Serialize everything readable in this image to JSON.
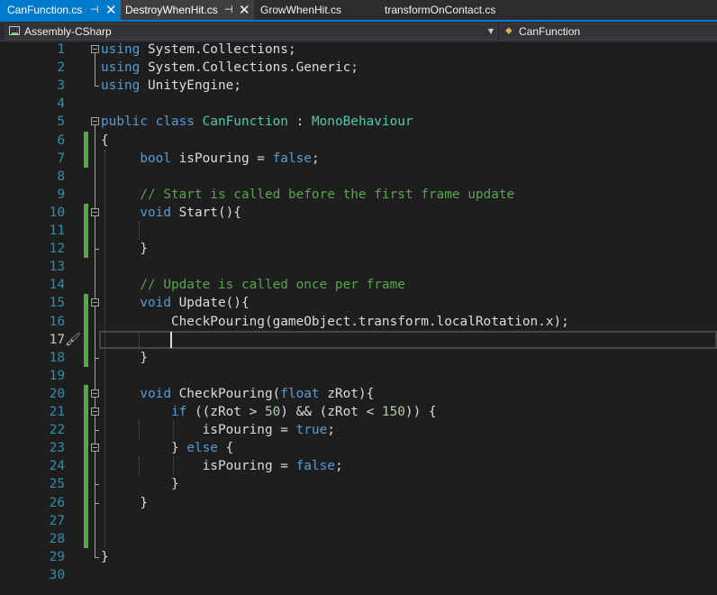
{
  "tabs": [
    {
      "label": "CanFunction.cs",
      "state": "active"
    },
    {
      "label": "DestroyWhenHit.cs",
      "state": "pinned"
    },
    {
      "label": "GrowWhenHit.cs",
      "state": "plain"
    },
    {
      "label": "transformOnContact.cs",
      "state": "plain"
    }
  ],
  "navbar": {
    "project": "Assembly-CSharp",
    "member": "CanFunction"
  },
  "editor": {
    "current_line": 17,
    "lines": [
      {
        "num": "1",
        "segments": [
          {
            "t": "using",
            "c": "k"
          },
          {
            "t": " System.Collections;"
          }
        ]
      },
      {
        "num": "2",
        "segments": [
          {
            "t": "using",
            "c": "k"
          },
          {
            "t": " System.Collections.Generic;"
          }
        ]
      },
      {
        "num": "3",
        "segments": [
          {
            "t": "using",
            "c": "k"
          },
          {
            "t": " UnityEngine;"
          }
        ]
      },
      {
        "num": "4",
        "segments": []
      },
      {
        "num": "5",
        "segments": [
          {
            "t": "public",
            "c": "k"
          },
          {
            "t": " "
          },
          {
            "t": "class",
            "c": "k"
          },
          {
            "t": " "
          },
          {
            "t": "CanFunction",
            "c": "t"
          },
          {
            "t": " : "
          },
          {
            "t": "MonoBehaviour",
            "c": "t"
          }
        ]
      },
      {
        "num": "6",
        "segments": [
          {
            "t": "{"
          }
        ]
      },
      {
        "num": "7",
        "segments": [
          {
            "t": "     "
          },
          {
            "t": "bool",
            "c": "k"
          },
          {
            "t": " isPouring = "
          },
          {
            "t": "false",
            "c": "k"
          },
          {
            "t": ";"
          }
        ]
      },
      {
        "num": "8",
        "segments": []
      },
      {
        "num": "9",
        "segments": [
          {
            "t": "     "
          },
          {
            "t": "// Start is called before the first frame update",
            "c": "c"
          }
        ]
      },
      {
        "num": "10",
        "segments": [
          {
            "t": "     "
          },
          {
            "t": "void",
            "c": "k"
          },
          {
            "t": " Start(){"
          }
        ]
      },
      {
        "num": "11",
        "segments": []
      },
      {
        "num": "12",
        "segments": [
          {
            "t": "     }"
          }
        ]
      },
      {
        "num": "13",
        "segments": []
      },
      {
        "num": "14",
        "segments": [
          {
            "t": "     "
          },
          {
            "t": "// Update is called once per frame",
            "c": "c"
          }
        ]
      },
      {
        "num": "15",
        "segments": [
          {
            "t": "     "
          },
          {
            "t": "void",
            "c": "k"
          },
          {
            "t": " Update(){"
          }
        ]
      },
      {
        "num": "16",
        "segments": [
          {
            "t": "         CheckPouring(gameObject.transform.localRotation.x);"
          }
        ]
      },
      {
        "num": "17",
        "segments": []
      },
      {
        "num": "18",
        "segments": [
          {
            "t": "     }"
          }
        ]
      },
      {
        "num": "19",
        "segments": []
      },
      {
        "num": "20",
        "segments": [
          {
            "t": "     "
          },
          {
            "t": "void",
            "c": "k"
          },
          {
            "t": " CheckPouring("
          },
          {
            "t": "float",
            "c": "k"
          },
          {
            "t": " zRot){"
          }
        ]
      },
      {
        "num": "21",
        "segments": [
          {
            "t": "         "
          },
          {
            "t": "if",
            "c": "k"
          },
          {
            "t": " ((zRot > "
          },
          {
            "t": "50",
            "c": "n"
          },
          {
            "t": ") && (zRot < "
          },
          {
            "t": "150",
            "c": "n"
          },
          {
            "t": ")) {"
          }
        ]
      },
      {
        "num": "22",
        "segments": [
          {
            "t": "             isPouring = "
          },
          {
            "t": "true",
            "c": "k"
          },
          {
            "t": ";"
          }
        ]
      },
      {
        "num": "23",
        "segments": [
          {
            "t": "         } "
          },
          {
            "t": "else",
            "c": "k"
          },
          {
            "t": " {"
          }
        ]
      },
      {
        "num": "24",
        "segments": [
          {
            "t": "             isPouring = "
          },
          {
            "t": "false",
            "c": "k"
          },
          {
            "t": ";"
          }
        ]
      },
      {
        "num": "25",
        "segments": [
          {
            "t": "         }"
          }
        ]
      },
      {
        "num": "26",
        "segments": [
          {
            "t": "     }"
          }
        ]
      },
      {
        "num": "27",
        "segments": []
      },
      {
        "num": "28",
        "segments": []
      },
      {
        "num": "29",
        "segments": [
          {
            "t": "}"
          }
        ]
      },
      {
        "num": "30",
        "segments": []
      }
    ]
  }
}
